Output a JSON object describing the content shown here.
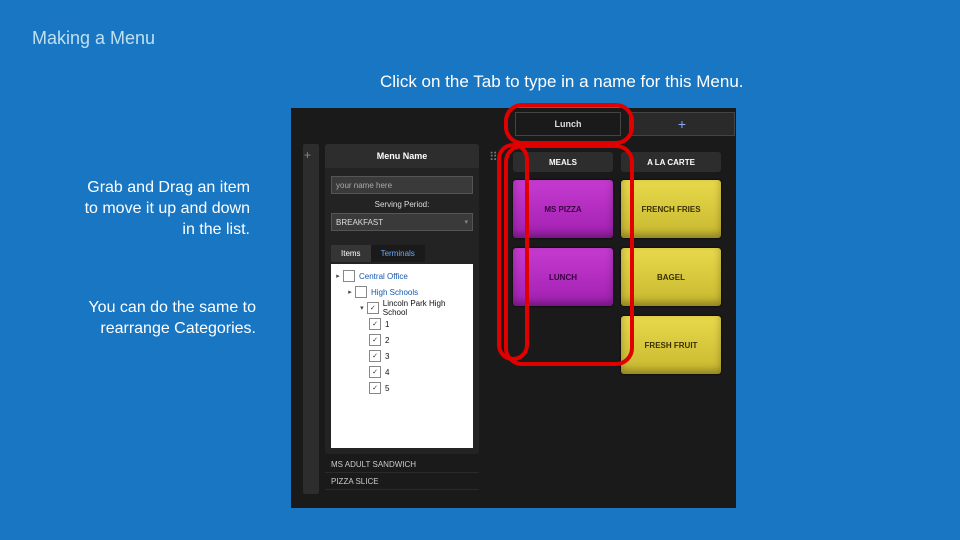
{
  "title": "Making a Menu",
  "instructions": {
    "top": "Click on the Tab to type in a name for this Menu.",
    "left1": "Grab and Drag an item to move it up and down in the list.",
    "left2": "You can do the same to rearrange Categories."
  },
  "app": {
    "tabs": {
      "active": "Lunch",
      "add": "+"
    },
    "panel": {
      "heading": "Menu Name",
      "name_placeholder": "your name here",
      "period_label": "Serving Period:",
      "period_value": "BREAKFAST"
    },
    "subtabs": {
      "a": "Items",
      "b": "Terminals"
    },
    "tree": {
      "n0": "Central Office",
      "n1": "High Schools",
      "n2": "Lincoln Park High School",
      "c1": "1",
      "c2": "2",
      "c3": "3",
      "c4": "4",
      "c5": "5"
    },
    "bottom": {
      "r1": "MS ADULT SANDWICH",
      "r2": "PIZZA SLICE"
    },
    "categories": {
      "c1": "MEALS",
      "c2": "A LA CARTE"
    },
    "tiles": {
      "t1": "MS PIZZA",
      "t2": "LUNCH",
      "t3": "FRENCH FRIES",
      "t4": "BAGEL",
      "t5": "FRESH FRUIT"
    },
    "icons": {
      "plus": "+",
      "grip": "⠿",
      "caret": "▾"
    }
  }
}
